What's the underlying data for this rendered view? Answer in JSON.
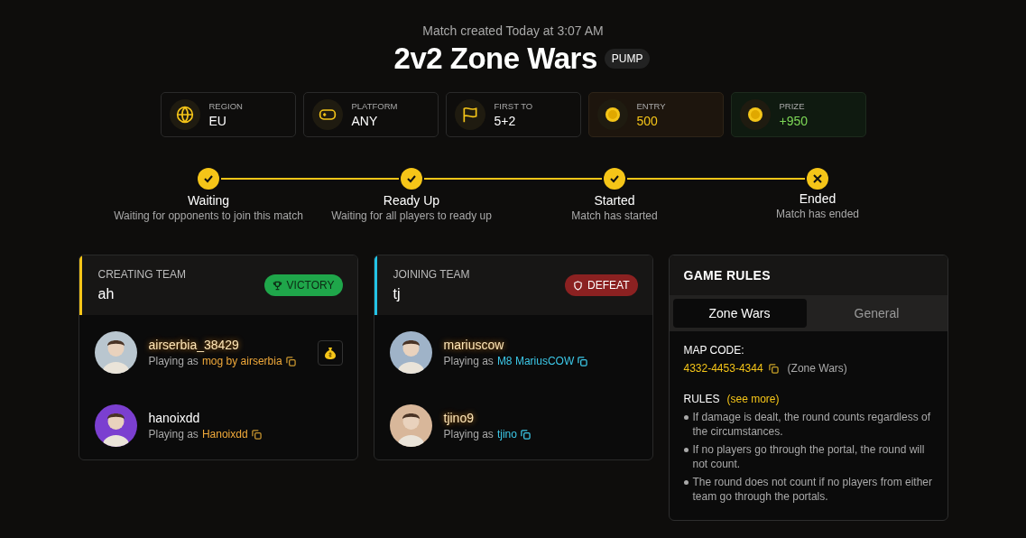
{
  "header": {
    "created": "Match created Today at 3:07 AM",
    "title": "2v2 Zone Wars",
    "tag": "PUMP"
  },
  "stats": [
    {
      "kind": "globe",
      "label": "REGION",
      "value": "EU"
    },
    {
      "kind": "gamepad",
      "label": "PLATFORM",
      "value": "ANY"
    },
    {
      "kind": "flag",
      "label": "FIRST TO",
      "value": "5+2"
    },
    {
      "kind": "entry",
      "label": "ENTRY",
      "value": "500"
    },
    {
      "kind": "prize",
      "label": "PRIZE",
      "value": "+950"
    }
  ],
  "steps": [
    {
      "kind": "done",
      "title": "Waiting",
      "subtitle": "Waiting for opponents to join this match"
    },
    {
      "kind": "done",
      "title": "Ready Up",
      "subtitle": "Waiting for all players to ready up"
    },
    {
      "kind": "done",
      "title": "Started",
      "subtitle": "Match has started"
    },
    {
      "kind": "ended",
      "title": "Ended",
      "subtitle": "Match has ended"
    }
  ],
  "teams": [
    {
      "label": "CREATING TEAM",
      "name": "ah",
      "color": "#f5c518",
      "result": {
        "kind": "victory",
        "text": "VICTORY"
      },
      "players": [
        {
          "name": "airserbia_38429",
          "highlighted": true,
          "prefix": "Playing as",
          "ingame": "mog by airserbia",
          "color": "#b9c6cf",
          "money_bag": true
        },
        {
          "name": "hanoixdd",
          "highlighted": false,
          "prefix": "Playing as",
          "ingame": "Hanoixdd",
          "color": "#7b3fd0",
          "money_bag": false
        }
      ]
    },
    {
      "label": "JOINING TEAM",
      "name": "tj",
      "color": "#22c3e6",
      "result": {
        "kind": "defeat",
        "text": "DEFEAT"
      },
      "players": [
        {
          "name": "mariuscow",
          "highlighted": true,
          "prefix": "Playing as",
          "ingame": "M8 MariusCOW",
          "color": "#9fb3c8",
          "money_bag": false
        },
        {
          "name": "tjino9",
          "highlighted": true,
          "prefix": "Playing as",
          "ingame": "tjino",
          "color": "#d8b79a",
          "money_bag": false
        }
      ]
    }
  ],
  "rules": {
    "title": "GAME RULES",
    "tabs": [
      {
        "label": "Zone Wars",
        "selected": true
      },
      {
        "label": "General",
        "selected": false
      }
    ],
    "map_code_label": "MAP CODE:",
    "map_code": "4332-4453-4344",
    "map_name": "(Zone Wars)",
    "rules_label": "RULES",
    "see_more": "(see more)",
    "items": [
      "If damage is dealt, the round counts regardless of the circumstances.",
      "If no players go through the portal, the round will not count.",
      "The round does not count if no players from either team go through the portals."
    ]
  }
}
